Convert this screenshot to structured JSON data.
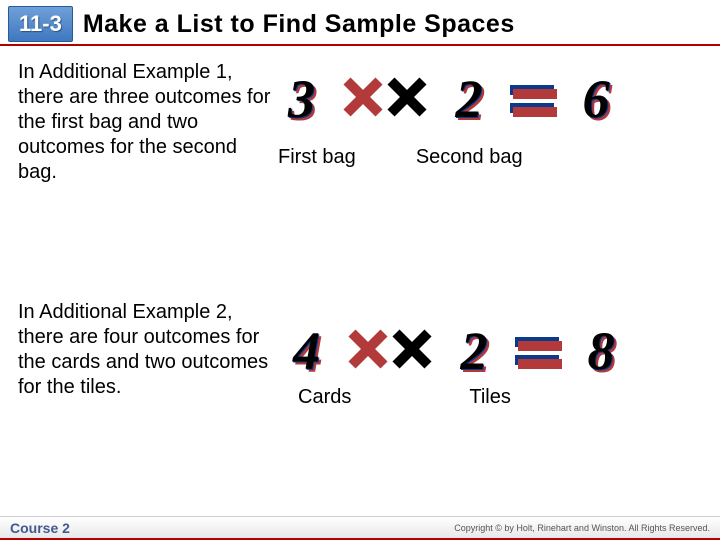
{
  "header": {
    "lesson_tag": "11-3",
    "title": "Make a List to Find Sample Spaces"
  },
  "example1": {
    "text": "In Additional Example 1, there are three outcomes for the first bag and two outcomes for the second bag.",
    "n1": "3",
    "n2": "2",
    "result": "6",
    "label1": "First bag",
    "label2": "Second bag"
  },
  "example2": {
    "text": "In Additional Example 2, there are four outcomes for the cards and two outcomes for the tiles.",
    "n1": "4",
    "n2": "2",
    "result": "8",
    "label1": "Cards",
    "label2": "Tiles"
  },
  "footer": {
    "course": "Course 2",
    "copyright": "Copyright © by Holt, Rinehart and Winston. All Rights Reserved."
  }
}
